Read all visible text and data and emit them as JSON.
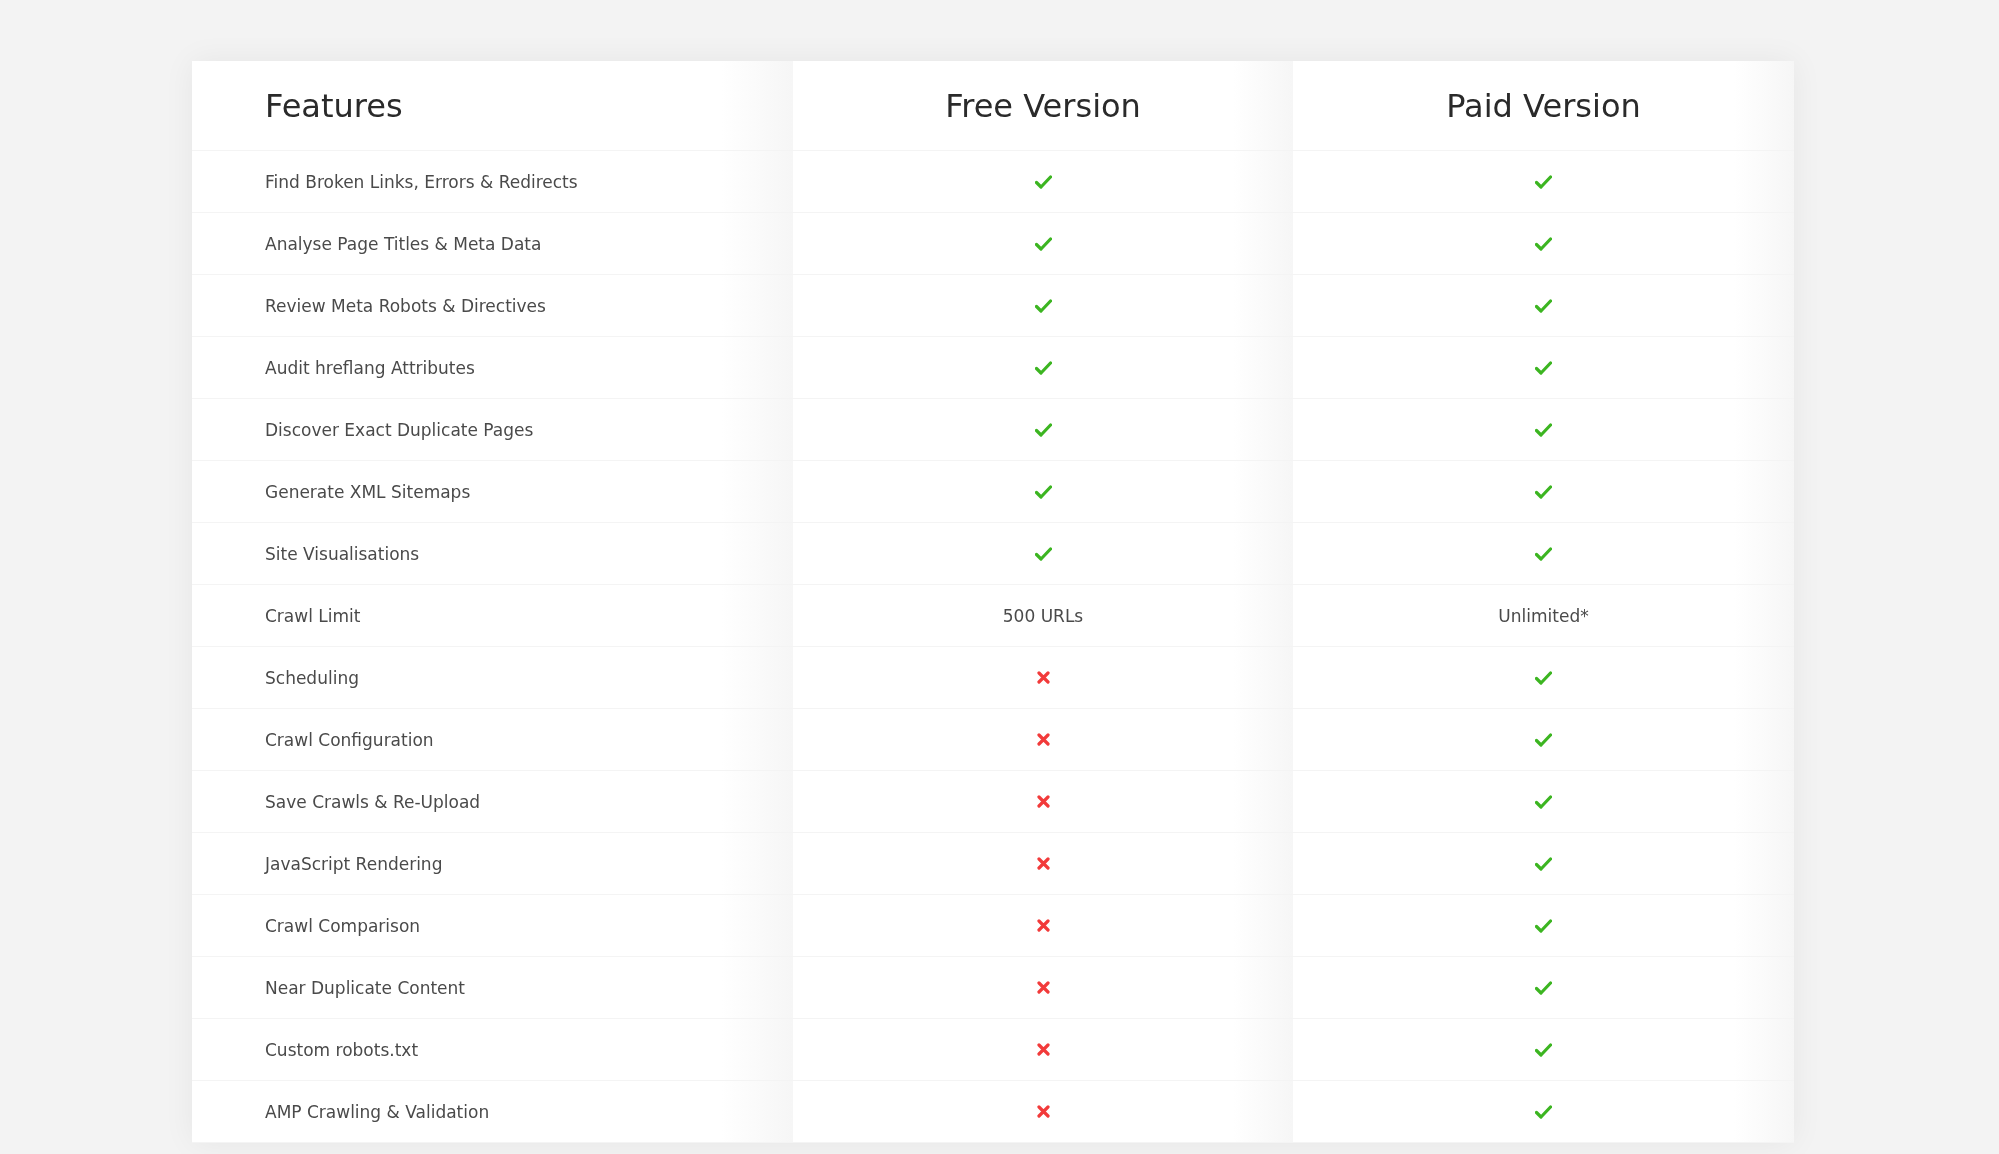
{
  "columns": [
    "Features",
    "Free Version",
    "Paid Version"
  ],
  "rows": [
    {
      "feature": "Find Broken Links, Errors & Redirects",
      "free": {
        "kind": "yes"
      },
      "paid": {
        "kind": "yes"
      }
    },
    {
      "feature": "Analyse Page Titles & Meta Data",
      "free": {
        "kind": "yes"
      },
      "paid": {
        "kind": "yes"
      }
    },
    {
      "feature": "Review Meta Robots & Directives",
      "free": {
        "kind": "yes"
      },
      "paid": {
        "kind": "yes"
      }
    },
    {
      "feature": "Audit hreflang Attributes",
      "free": {
        "kind": "yes"
      },
      "paid": {
        "kind": "yes"
      }
    },
    {
      "feature": "Discover Exact Duplicate Pages",
      "free": {
        "kind": "yes"
      },
      "paid": {
        "kind": "yes"
      }
    },
    {
      "feature": "Generate XML Sitemaps",
      "free": {
        "kind": "yes"
      },
      "paid": {
        "kind": "yes"
      }
    },
    {
      "feature": "Site Visualisations",
      "free": {
        "kind": "yes"
      },
      "paid": {
        "kind": "yes"
      }
    },
    {
      "feature": "Crawl Limit",
      "free": {
        "kind": "text",
        "text": "500 URLs"
      },
      "paid": {
        "kind": "text",
        "text": "Unlimited*"
      }
    },
    {
      "feature": "Scheduling",
      "free": {
        "kind": "no"
      },
      "paid": {
        "kind": "yes"
      }
    },
    {
      "feature": "Crawl Configuration",
      "free": {
        "kind": "no"
      },
      "paid": {
        "kind": "yes"
      }
    },
    {
      "feature": "Save Crawls & Re-Upload",
      "free": {
        "kind": "no"
      },
      "paid": {
        "kind": "yes"
      }
    },
    {
      "feature": "JavaScript Rendering",
      "free": {
        "kind": "no"
      },
      "paid": {
        "kind": "yes"
      }
    },
    {
      "feature": "Crawl Comparison",
      "free": {
        "kind": "no"
      },
      "paid": {
        "kind": "yes"
      }
    },
    {
      "feature": "Near Duplicate Content",
      "free": {
        "kind": "no"
      },
      "paid": {
        "kind": "yes"
      }
    },
    {
      "feature": "Custom robots.txt",
      "free": {
        "kind": "no"
      },
      "paid": {
        "kind": "yes"
      }
    },
    {
      "feature": "AMP Crawling & Validation",
      "free": {
        "kind": "no"
      },
      "paid": {
        "kind": "yes"
      }
    }
  ]
}
